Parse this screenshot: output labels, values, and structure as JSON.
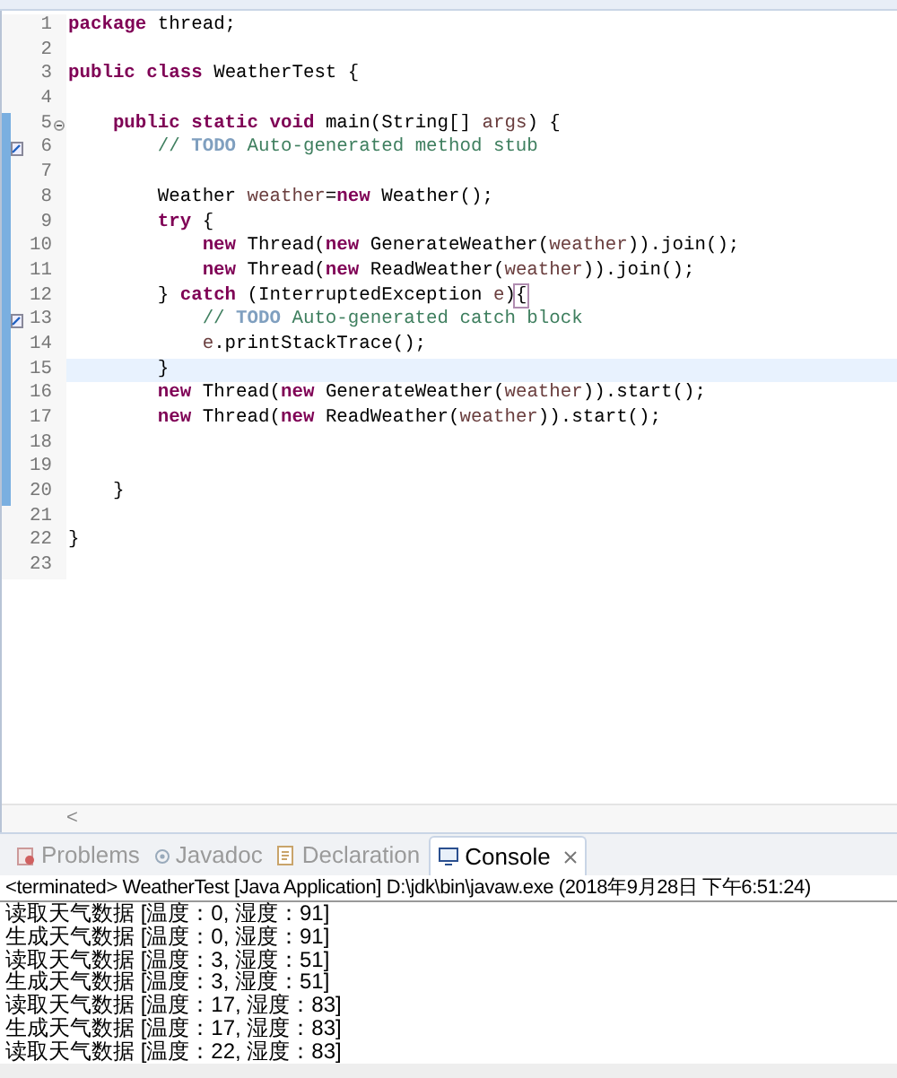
{
  "editor": {
    "lines": [
      {
        "number": "1",
        "ruler_mark": false,
        "current": false,
        "fold_control": false,
        "task_marker": false,
        "segments": [
          {
            "kind": "keyword",
            "text": "package"
          },
          {
            "kind": "plain",
            "text": " thread;"
          }
        ]
      },
      {
        "number": "2",
        "ruler_mark": false,
        "current": false,
        "fold_control": false,
        "task_marker": false
      },
      {
        "number": "3",
        "ruler_mark": false,
        "current": false,
        "fold_control": false,
        "task_marker": false,
        "segments": [
          {
            "kind": "keyword",
            "text": "public"
          },
          {
            "kind": "keyword",
            "text": " class"
          },
          {
            "kind": "plain",
            "text": " WeatherTest {"
          }
        ]
      },
      {
        "number": "4",
        "ruler_mark": false,
        "current": false,
        "fold_control": false,
        "task_marker": false
      },
      {
        "number": "5",
        "ruler_mark": true,
        "current": false,
        "fold_control": true,
        "task_marker": false,
        "segments": [
          {
            "kind": "keyword",
            "text": "    public"
          },
          {
            "kind": "keyword",
            "text": " static"
          },
          {
            "kind": "keyword",
            "text": " void"
          },
          {
            "kind": "plain",
            "text": " main(String[]"
          },
          {
            "kind": "variable",
            "text": " args"
          },
          {
            "kind": "plain",
            "text": ") {"
          }
        ]
      },
      {
        "number": "6",
        "ruler_mark": true,
        "current": false,
        "fold_control": false,
        "task_marker": true,
        "segments": [
          {
            "kind": "comment",
            "text": "        //"
          },
          {
            "kind": "todo",
            "text": " TODO"
          },
          {
            "kind": "comment",
            "text": " Auto-generated method stub"
          }
        ]
      },
      {
        "number": "7",
        "ruler_mark": true,
        "current": false,
        "fold_control": false,
        "task_marker": false
      },
      {
        "number": "8",
        "ruler_mark": true,
        "current": false,
        "fold_control": false,
        "task_marker": false,
        "segments": [
          {
            "kind": "plain",
            "text": "        Weather"
          },
          {
            "kind": "variable",
            "text": " weather"
          },
          {
            "kind": "plain",
            "text": "="
          },
          {
            "kind": "keyword",
            "text": "new"
          },
          {
            "kind": "plain",
            "text": " Weather();"
          }
        ]
      },
      {
        "number": "9",
        "ruler_mark": true,
        "current": false,
        "fold_control": false,
        "task_marker": false,
        "segments": [
          {
            "kind": "keyword",
            "text": "        try"
          },
          {
            "kind": "plain",
            "text": " {"
          }
        ]
      },
      {
        "number": "10",
        "ruler_mark": true,
        "current": false,
        "fold_control": false,
        "task_marker": false,
        "segments": [
          {
            "kind": "keyword",
            "text": "            new"
          },
          {
            "kind": "plain",
            "text": " Thread("
          },
          {
            "kind": "keyword",
            "text": "new"
          },
          {
            "kind": "plain",
            "text": " GenerateWeather("
          },
          {
            "kind": "variable",
            "text": "weather"
          },
          {
            "kind": "plain",
            "text": ")).join();"
          }
        ]
      },
      {
        "number": "11",
        "ruler_mark": true,
        "current": false,
        "fold_control": false,
        "task_marker": false,
        "segments": [
          {
            "kind": "keyword",
            "text": "            new"
          },
          {
            "kind": "plain",
            "text": " Thread("
          },
          {
            "kind": "keyword",
            "text": "new"
          },
          {
            "kind": "plain",
            "text": " ReadWeather("
          },
          {
            "kind": "variable",
            "text": "weather"
          },
          {
            "kind": "plain",
            "text": ")).join();"
          }
        ]
      },
      {
        "number": "12",
        "ruler_mark": true,
        "current": false,
        "fold_control": false,
        "task_marker": false,
        "segments": [
          {
            "kind": "plain",
            "text": "        }"
          },
          {
            "kind": "keyword",
            "text": " catch"
          },
          {
            "kind": "plain",
            "text": " (InterruptedException"
          },
          {
            "kind": "variable",
            "text": " e"
          },
          {
            "kind": "plain",
            "text": ")"
          },
          {
            "kind": "bracket",
            "text": "{"
          }
        ]
      },
      {
        "number": "13",
        "ruler_mark": true,
        "current": false,
        "fold_control": false,
        "task_marker": true,
        "segments": [
          {
            "kind": "comment",
            "text": "            //"
          },
          {
            "kind": "todo",
            "text": " TODO"
          },
          {
            "kind": "comment",
            "text": " Auto-generated catch block"
          }
        ]
      },
      {
        "number": "14",
        "ruler_mark": true,
        "current": false,
        "fold_control": false,
        "task_marker": false,
        "segments": [
          {
            "kind": "variable",
            "text": "            e"
          },
          {
            "kind": "plain",
            "text": ".printStackTrace();"
          }
        ]
      },
      {
        "number": "15",
        "ruler_mark": true,
        "current": true,
        "fold_control": false,
        "task_marker": false,
        "segments": [
          {
            "kind": "plain",
            "text": "        }"
          }
        ]
      },
      {
        "number": "16",
        "ruler_mark": true,
        "current": false,
        "fold_control": false,
        "task_marker": false,
        "segments": [
          {
            "kind": "keyword",
            "text": "        new"
          },
          {
            "kind": "plain",
            "text": " Thread("
          },
          {
            "kind": "keyword",
            "text": "new"
          },
          {
            "kind": "plain",
            "text": " GenerateWeather("
          },
          {
            "kind": "variable",
            "text": "weather"
          },
          {
            "kind": "plain",
            "text": ")).start();"
          }
        ]
      },
      {
        "number": "17",
        "ruler_mark": true,
        "current": false,
        "fold_control": false,
        "task_marker": false,
        "segments": [
          {
            "kind": "keyword",
            "text": "        new"
          },
          {
            "kind": "plain",
            "text": " Thread("
          },
          {
            "kind": "keyword",
            "text": "new"
          },
          {
            "kind": "plain",
            "text": " ReadWeather("
          },
          {
            "kind": "variable",
            "text": "weather"
          },
          {
            "kind": "plain",
            "text": ")).start();"
          }
        ]
      },
      {
        "number": "18",
        "ruler_mark": true,
        "current": false,
        "fold_control": false,
        "task_marker": false
      },
      {
        "number": "19",
        "ruler_mark": true,
        "current": false,
        "fold_control": false,
        "task_marker": false
      },
      {
        "number": "20",
        "ruler_mark": true,
        "current": false,
        "fold_control": false,
        "task_marker": false,
        "segments": [
          {
            "kind": "plain",
            "text": "    }"
          }
        ]
      },
      {
        "number": "21",
        "ruler_mark": false,
        "current": false,
        "fold_control": false,
        "task_marker": false
      },
      {
        "number": "22",
        "ruler_mark": false,
        "current": false,
        "fold_control": false,
        "task_marker": false,
        "segments": [
          {
            "kind": "plain",
            "text": "}"
          }
        ]
      },
      {
        "number": "23",
        "ruler_mark": false,
        "current": false,
        "fold_control": false,
        "task_marker": false
      }
    ],
    "scroll_left": "<"
  },
  "views": {
    "tabs": [
      {
        "label": "Problems",
        "kind": "problems",
        "selected": false
      },
      {
        "label": "Javadoc",
        "kind": "javadoc",
        "selected": false
      },
      {
        "label": "Declaration",
        "kind": "declaration",
        "selected": false
      },
      {
        "label": "Console",
        "kind": "console",
        "selected": true
      }
    ]
  },
  "console": {
    "header": "<terminated> WeatherTest [Java Application] D:\\jdk\\bin\\javaw.exe (2018年9月28日 下午6:51:24)",
    "output": [
      "读取天气数据 [温度：0, 湿度：91]",
      "生成天气数据 [温度：0, 湿度：91]",
      "读取天气数据 [温度：3, 湿度：51]",
      "生成天气数据 [温度：3, 湿度：51]",
      "读取天气数据 [温度：17, 湿度：83]",
      "生成天气数据 [温度：17, 湿度：83]",
      "读取天气数据 [温度：22, 湿度：83]"
    ]
  }
}
